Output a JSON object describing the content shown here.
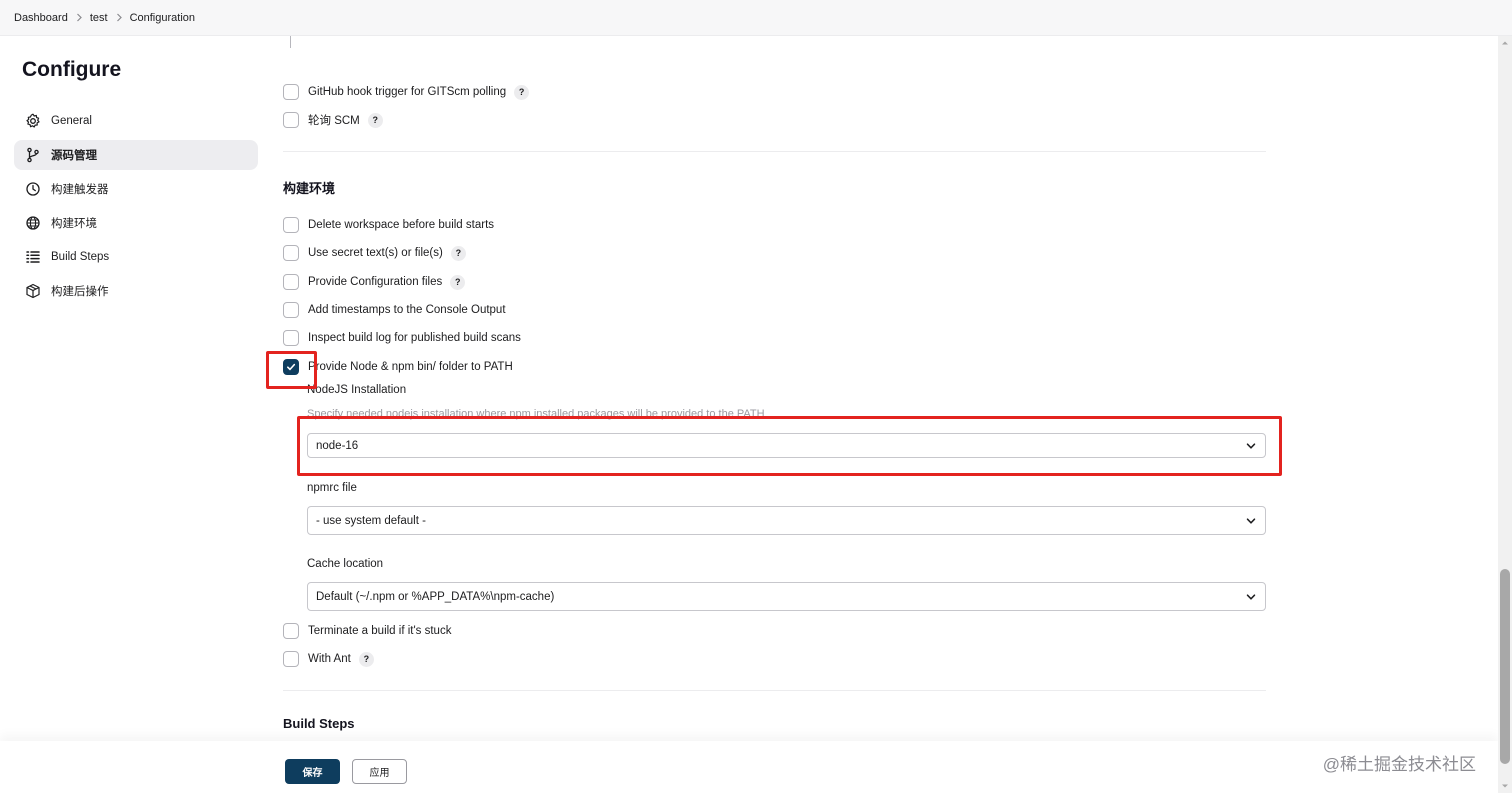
{
  "breadcrumb": {
    "items": [
      "Dashboard",
      "test",
      "Configuration"
    ]
  },
  "sidebar": {
    "title": "Configure",
    "items": [
      {
        "label": "General",
        "icon": "gear-icon",
        "active": false
      },
      {
        "label": "源码管理",
        "icon": "branch-icon",
        "active": true
      },
      {
        "label": "构建触发器",
        "icon": "clock-icon",
        "active": false
      },
      {
        "label": "构建环境",
        "icon": "globe-icon",
        "active": false
      },
      {
        "label": "Build Steps",
        "icon": "list-icon",
        "active": false
      },
      {
        "label": "构建后操作",
        "icon": "package-icon",
        "active": false
      }
    ]
  },
  "triggers": {
    "github_hook": "GitHub hook trigger for GITScm polling",
    "poll_scm": "轮询 SCM"
  },
  "build_env": {
    "title": "构建环境",
    "options": [
      {
        "label": "Delete workspace before build starts",
        "checked": false,
        "help": false
      },
      {
        "label": "Use secret text(s) or file(s)",
        "checked": false,
        "help": true
      },
      {
        "label": "Provide Configuration files",
        "checked": false,
        "help": true
      },
      {
        "label": "Add timestamps to the Console Output",
        "checked": false,
        "help": false
      },
      {
        "label": "Inspect build log for published build scans",
        "checked": false,
        "help": false
      },
      {
        "label": "Provide Node & npm bin/ folder to PATH",
        "checked": true,
        "help": false
      }
    ],
    "nodejs": {
      "label": "NodeJS Installation",
      "description": "Specify needed nodejs installation where npm installed packages will be provided to the PATH",
      "value": "node-16"
    },
    "npmrc": {
      "label": "npmrc file",
      "value": "- use system default -"
    },
    "cache": {
      "label": "Cache location",
      "value": "Default (~/.npm or %APP_DATA%\\npm-cache)"
    },
    "after_options": [
      {
        "label": "Terminate a build if it's stuck",
        "checked": false,
        "help": false
      },
      {
        "label": "With Ant",
        "checked": false,
        "help": true
      }
    ]
  },
  "build_steps": {
    "title": "Build Steps"
  },
  "help_glyph": "?",
  "footer": {
    "save_label": "保存",
    "apply_label": "应用"
  },
  "watermark": "@稀土掘金技术社区",
  "colors": {
    "accent": "#0e3d5e",
    "annotation": "#e3231f",
    "active_nav": "#ededf0"
  }
}
